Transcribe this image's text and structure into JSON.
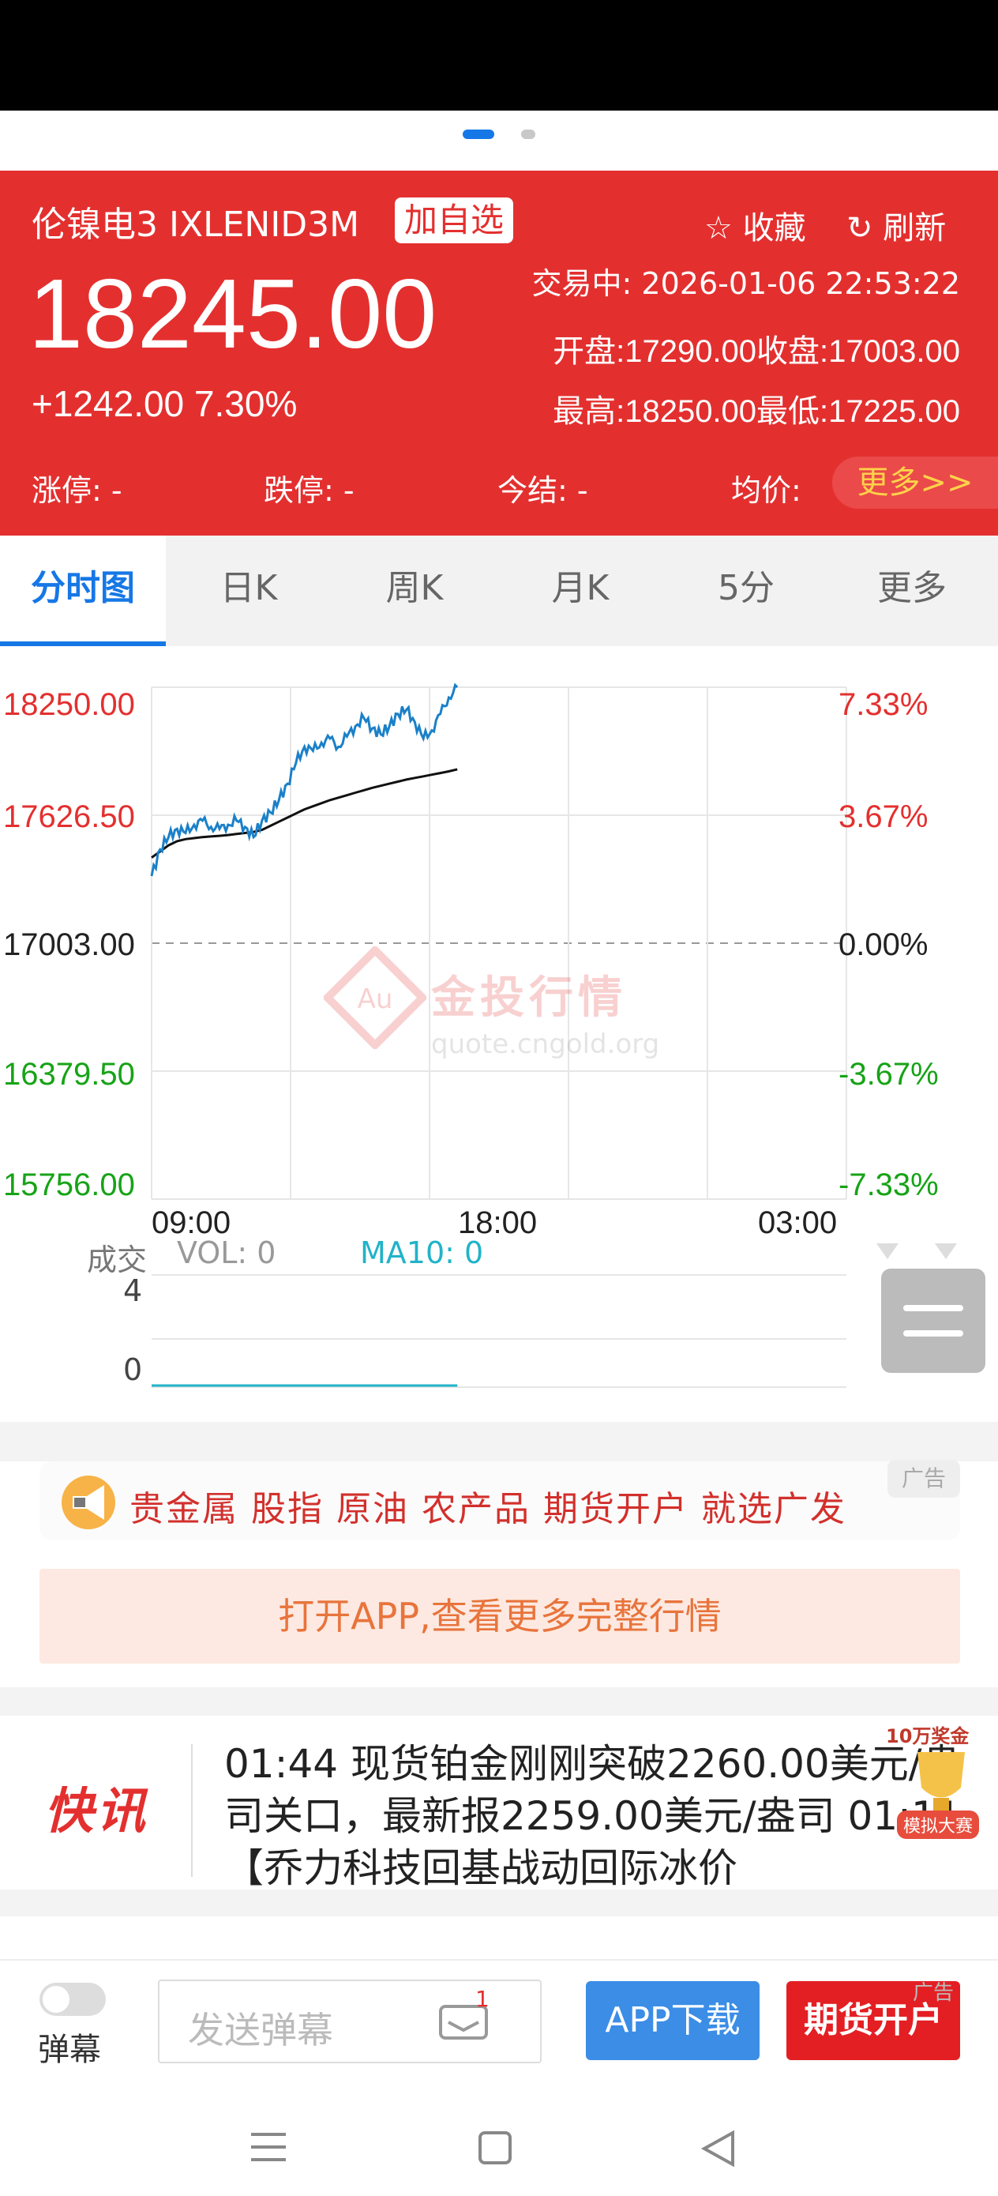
{
  "header": {
    "name": "伦镍电3 IXLENID3M",
    "add_watch": "加自选",
    "favorite": "收藏",
    "refresh": "刷新",
    "price": "18245.00",
    "change": "+1242.00 7.30%",
    "trade_time": "交易中: 2026-01-06 22:53:22",
    "open_close": "开盘:17290.00收盘:17003.00",
    "high_low": "最高:18250.00最低:17225.00",
    "limit_up": "涨停: -",
    "limit_down": "跌停: -",
    "settle": "今结: -",
    "avg_label": "均价:",
    "more": "更多>>"
  },
  "tabs": [
    "分时图",
    "日K",
    "周K",
    "月K",
    "5分",
    "更多"
  ],
  "chart": {
    "left_axis": [
      "18250.00",
      "17626.50",
      "17003.00",
      "16379.50",
      "15756.00"
    ],
    "right_axis": [
      "7.33%",
      "3.67%",
      "0.00%",
      "-3.67%",
      "-7.33%"
    ],
    "time_labels": [
      "09:00",
      "18:00",
      "03:00"
    ],
    "watermark_title": "金投行情",
    "watermark_url": "quote.cngold.org",
    "watermark_logo_text": "Au",
    "vol_title": "成交",
    "vol_value": "VOL: 0",
    "ma_value": "MA10: 0",
    "vol_ticks": [
      "4",
      "0"
    ]
  },
  "chart_data": {
    "type": "line",
    "ylim": [
      15756.0,
      18250.0
    ],
    "reference_close": 17003.0,
    "x_range": [
      "09:00",
      "03:00"
    ],
    "series": [],
    "price_points": [
      17330,
      17460,
      17520,
      17560,
      17540,
      17580,
      17600,
      17570,
      17560,
      17580,
      17600,
      17570,
      17520,
      17600,
      17640,
      17700,
      17780,
      17880,
      17960,
      17940,
      17980,
      18000,
      17960,
      18010,
      18060,
      18100,
      18050,
      18020,
      18060,
      18120,
      18140,
      18080,
      18000,
      18040,
      18120,
      18200,
      18250
    ],
    "avg_points": [
      17420,
      17450,
      17480,
      17500,
      17510,
      17515,
      17520,
      17523,
      17526,
      17530,
      17535,
      17540,
      17545,
      17555,
      17575,
      17595,
      17615,
      17635,
      17655,
      17670,
      17685,
      17700,
      17712,
      17724,
      17736,
      17748,
      17760,
      17770,
      17780,
      17790,
      17800,
      17808,
      17816,
      17824,
      17832,
      17840,
      17850
    ],
    "volume": [
      0
    ],
    "grid": true
  },
  "ads": {
    "banner_text": "贵金属 股指 原油 农产品 期货开户 就选广发",
    "ad_badge": "广告",
    "open_app": "打开APP,查看更多完整行情"
  },
  "news": {
    "tag": "快讯",
    "text": "01:44  现货铂金刚刚突破2260.00美元/盎司关口，最新报2259.00美元/盎司 01:11 【乔力科技回基战动回际冰价",
    "award_title": "10万奖金",
    "award_sub": "模拟大赛"
  },
  "bottom": {
    "toggle_label": "弹幕",
    "input_placeholder": "发送弹幕",
    "msg_count": "1",
    "app_download": "APP下载",
    "open_account": "期货开户",
    "ad_tag": "广告"
  },
  "colors": {
    "header_red": "#e3302f",
    "accent_blue": "#1677e6",
    "up_red": "#e3302f",
    "down_green": "#17a317",
    "price_line": "#1a80c8",
    "avg_line": "#111111",
    "more_yellow": "#ffd24a"
  }
}
